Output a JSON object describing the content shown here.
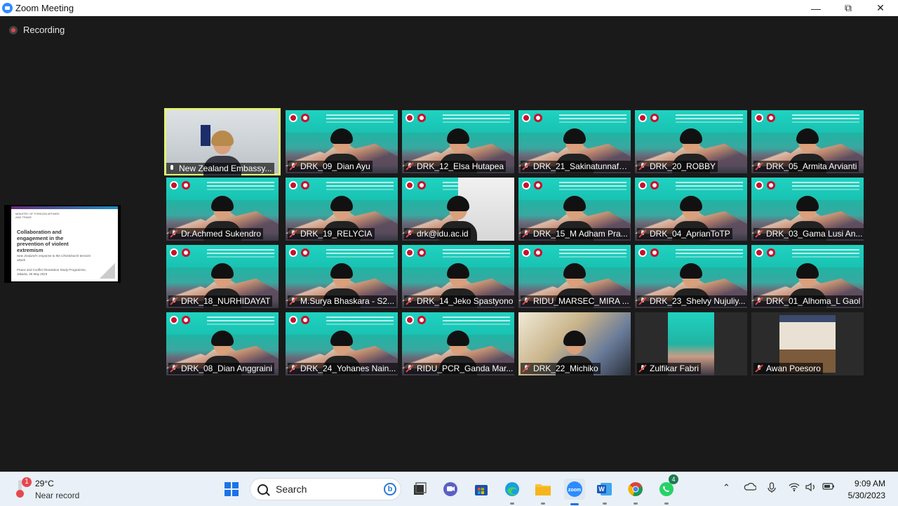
{
  "window": {
    "title": "Zoom Meeting"
  },
  "recording": {
    "label": "Recording"
  },
  "shared_screen": {
    "org_text": "MINISTRY OF FOREIGN AFFAIRS AND TRADE",
    "title": "Collaboration and engagement in the prevention of violent extremism",
    "subtitle": "New Zealand's response to the Christchurch terrorist attack",
    "footer": "Peace and Conflict Resolution Study Programme, Jakarta, 30 May 2023"
  },
  "participants": [
    {
      "name": "New Zealand Embassy...",
      "style": "office",
      "muted": false,
      "speaking": true
    },
    {
      "name": "DRK_09_Dian Ayu",
      "style": "green",
      "muted": true
    },
    {
      "name": "DRK_12_Elsa Hutapea",
      "style": "green",
      "muted": true
    },
    {
      "name": "DRK_21_Sakinatunnafs...",
      "style": "green",
      "muted": true
    },
    {
      "name": "DRK_20_ROBBY",
      "style": "green",
      "muted": true
    },
    {
      "name": "DRK_05_Armita Arvianti",
      "style": "green",
      "muted": true
    },
    {
      "name": "Dr.Achmed Sukendro",
      "style": "green",
      "muted": true
    },
    {
      "name": "DRK_19_RELYCIA",
      "style": "green",
      "muted": true
    },
    {
      "name": "drk@idu.ac.id",
      "style": "green-photo",
      "muted": true
    },
    {
      "name": "DRK_15_M Adham Pra...",
      "style": "green",
      "muted": true
    },
    {
      "name": "DRK_04_AprianToTP",
      "style": "green",
      "muted": true
    },
    {
      "name": "DRK_03_Gama Lusi An...",
      "style": "green",
      "muted": true
    },
    {
      "name": "DRK_18_NURHIDAYAT",
      "style": "green",
      "muted": true
    },
    {
      "name": "M.Surya Bhaskara - S2...",
      "style": "green",
      "muted": true
    },
    {
      "name": "DRK_14_Jeko Spastyono",
      "style": "green",
      "muted": true
    },
    {
      "name": "RIDU_MARSEC_MIRA ...",
      "style": "green",
      "muted": true
    },
    {
      "name": "DRK_23_Shelvy Nujuliy...",
      "style": "green",
      "muted": true
    },
    {
      "name": "DRK_01_Alhoma_L Gaol",
      "style": "green",
      "muted": true
    },
    {
      "name": "DRK_08_Dian Anggraini",
      "style": "green",
      "muted": true
    },
    {
      "name": "DRK_24_Yohanes Nain...",
      "style": "green",
      "muted": true
    },
    {
      "name": "RIDU_PCR_Ganda Mar...",
      "style": "green",
      "muted": true
    },
    {
      "name": "DRK_22_Michiko",
      "style": "room",
      "muted": true
    },
    {
      "name": "Zulfikar Fabri",
      "style": "narrow-green",
      "muted": true
    },
    {
      "name": "Awan Poesoro",
      "style": "narrow-photo",
      "muted": true
    }
  ],
  "taskbar": {
    "weather": {
      "badge": "1",
      "temperature": "29°C",
      "condition": "Near record"
    },
    "search_label": "Search",
    "whatsapp_badge": "4",
    "apps": [
      "windows-start",
      "search",
      "task-view",
      "teams-chat",
      "microsoft-store",
      "edge",
      "file-explorer",
      "zoom",
      "word",
      "chrome",
      "whatsapp"
    ],
    "clock": {
      "time": "9:09 AM",
      "date": "5/30/2023"
    }
  }
}
